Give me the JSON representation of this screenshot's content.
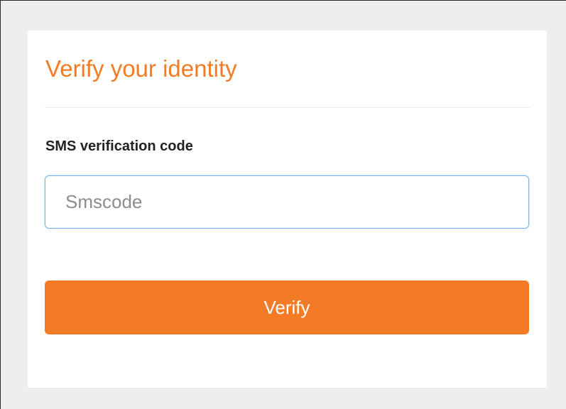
{
  "card": {
    "title": "Verify your identity",
    "sms_label": "SMS verification code",
    "sms_input": {
      "value": "",
      "placeholder": "Smscode"
    },
    "verify_label": "Verify"
  },
  "colors": {
    "accent": "#f37b25",
    "page_background": "#eeeeee",
    "card_background": "#ffffff",
    "input_focus_border": "#7ab2e6"
  }
}
